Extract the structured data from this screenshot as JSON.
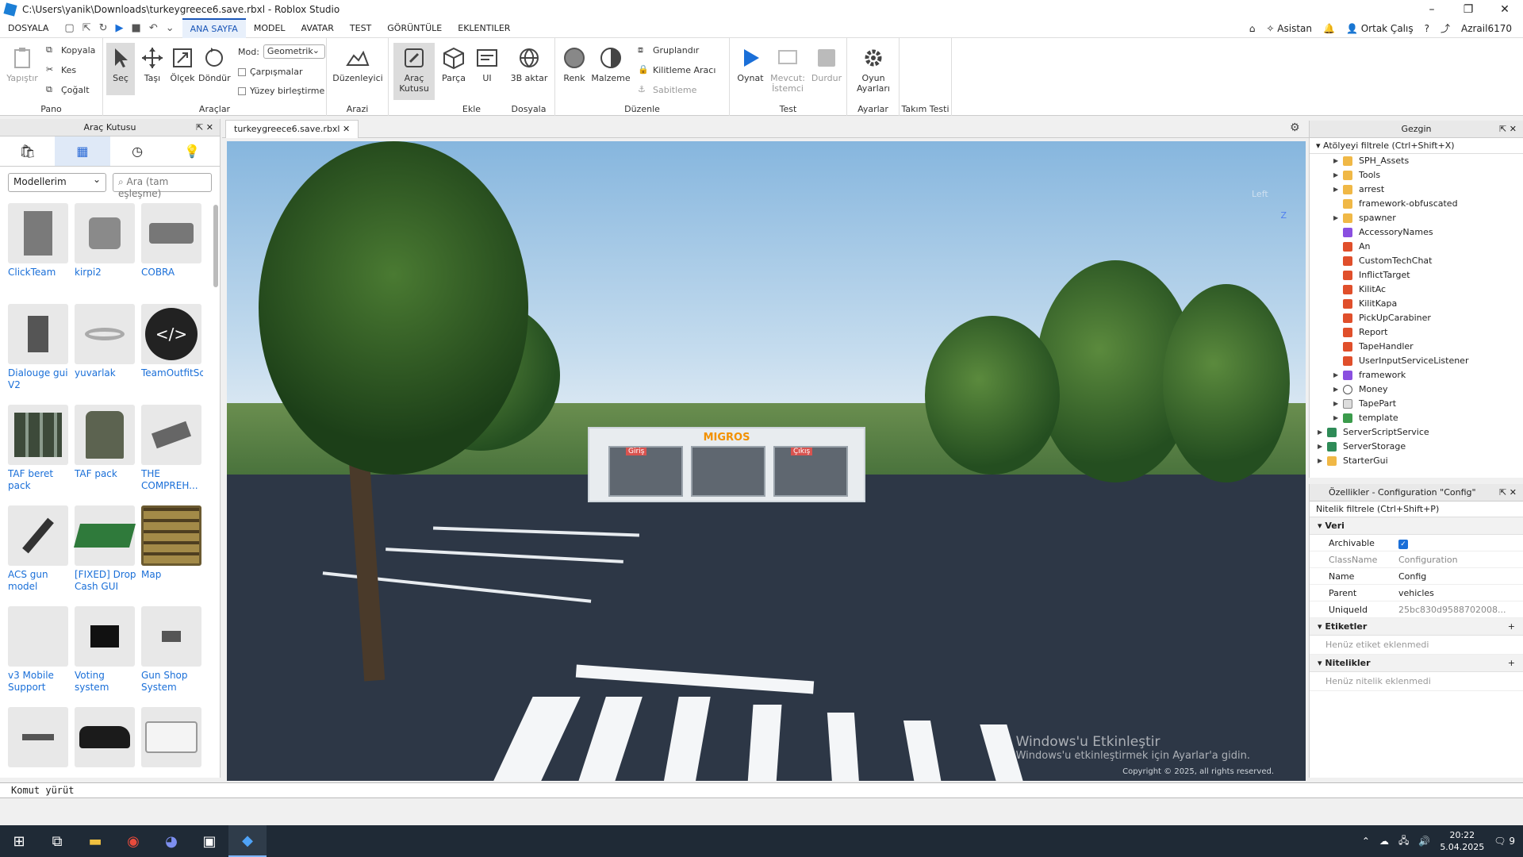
{
  "window": {
    "title": "C:\\Users\\yanik\\Downloads\\turkeygreece6.save.rbxl - Roblox Studio"
  },
  "menus": [
    "DOSYALA",
    "ANA SAYFA",
    "MODEL",
    "AVATAR",
    "TEST",
    "GÖRÜNTÜLE",
    "EKLENTILER"
  ],
  "menubar_right": {
    "assistant": "Asistan",
    "collab": "Ortak Çalış",
    "user": "Azrail6170"
  },
  "ribbon": {
    "pano": {
      "label": "Pano",
      "paste": "Yapıştır",
      "copy": "Kopyala",
      "cut": "Kes",
      "duplicate": "Çoğalt"
    },
    "araclar": {
      "label": "Araçlar",
      "select": "Seç",
      "move": "Taşı",
      "scale": "Ölçek",
      "rotate": "Döndür",
      "mode_label": "Mod:",
      "mode_value": "Geometrik",
      "collisions": "Çarpışmalar",
      "surface_join": "Yüzey birleştirme"
    },
    "arazi": {
      "label": "Arazi",
      "editor": "Düzenleyici"
    },
    "ekle": {
      "label": "Ekle",
      "toolbox": "Araç Kutusu",
      "part": "Parça",
      "ui": "UI"
    },
    "dosyala": {
      "label": "Dosyala",
      "import3d": "3B aktar"
    },
    "duzenle": {
      "label": "Düzenle",
      "color": "Renk",
      "material": "Malzeme",
      "group": "Gruplandır",
      "lock": "Kilitleme Aracı",
      "anchor": "Sabitleme"
    },
    "test": {
      "label": "Test",
      "play": "Oynat",
      "current": "Mevcut:",
      "client": "İstemci",
      "stop": "Durdur"
    },
    "ayarlar": {
      "label": "Ayarlar",
      "game_settings_1": "Oyun",
      "game_settings_2": "Ayarları"
    },
    "takim": {
      "label": "Takım Testi"
    }
  },
  "toolbox": {
    "title": "Araç Kutusu",
    "category": "Modellerim",
    "search_placeholder": "Ara (tam eşleşme)",
    "items": [
      "ClickTeam",
      "kirpi2",
      "COBRA",
      "Dialouge gui V2",
      "yuvarlak",
      "TeamOutfitScript",
      "TAF beret pack",
      "TAF pack",
      "THE COMPREH...",
      "ACS gun model",
      "[FIXED] Drop Cash GUI",
      "Map",
      "v3 Mobile Support",
      "Voting system",
      "Gun Shop System",
      "",
      "",
      ""
    ]
  },
  "document": {
    "tab": "turkeygreece6.save.rbxl"
  },
  "viewport": {
    "store_sign": "MIGROS",
    "door_label_1": "Giriş",
    "door_label_2": "Çıkış",
    "gizmo_label": "Left",
    "gizmo_axis": "Z",
    "footer": "Copyright © 2025, all rights reserved.",
    "activate_1": "Windows'u Etkinleştir",
    "activate_2": "Windows'u etkinleştirmek için Ayarlar'a gidin."
  },
  "explorer": {
    "title": "Gezgin",
    "filter": "Atölyeyi filtrele (Ctrl+Shift+X)",
    "rows": [
      {
        "name": "SPH_Assets",
        "icon": "folder",
        "indent": 1,
        "arrow": "▶"
      },
      {
        "name": "Tools",
        "icon": "folder",
        "indent": 1,
        "arrow": "▶"
      },
      {
        "name": "arrest",
        "icon": "folder",
        "indent": 1,
        "arrow": "▶"
      },
      {
        "name": "framework-obfuscated",
        "icon": "folder",
        "indent": 1,
        "arrow": ""
      },
      {
        "name": "spawner",
        "icon": "folder",
        "indent": 1,
        "arrow": "▶"
      },
      {
        "name": "AccessoryNames",
        "icon": "module",
        "indent": 1,
        "arrow": ""
      },
      {
        "name": "An",
        "icon": "script",
        "indent": 1,
        "arrow": ""
      },
      {
        "name": "CustomTechChat",
        "icon": "script",
        "indent": 1,
        "arrow": ""
      },
      {
        "name": "InflictTarget",
        "icon": "script",
        "indent": 1,
        "arrow": ""
      },
      {
        "name": "KilitAc",
        "icon": "script",
        "indent": 1,
        "arrow": ""
      },
      {
        "name": "KilitKapa",
        "icon": "script",
        "indent": 1,
        "arrow": ""
      },
      {
        "name": "PickUpCarabiner",
        "icon": "script",
        "indent": 1,
        "arrow": ""
      },
      {
        "name": "Report",
        "icon": "script",
        "indent": 1,
        "arrow": ""
      },
      {
        "name": "TapeHandler",
        "icon": "script",
        "indent": 1,
        "arrow": ""
      },
      {
        "name": "UserInputServiceListener",
        "icon": "script",
        "indent": 1,
        "arrow": ""
      },
      {
        "name": "framework",
        "icon": "module",
        "indent": 1,
        "arrow": "▶"
      },
      {
        "name": "Money",
        "icon": "globe",
        "indent": 1,
        "arrow": "▶"
      },
      {
        "name": "TapePart",
        "icon": "part",
        "indent": 1,
        "arrow": "▶"
      },
      {
        "name": "template",
        "icon": "green",
        "indent": 1,
        "arrow": "▶"
      },
      {
        "name": "ServerScriptService",
        "icon": "service",
        "indent": 0,
        "arrow": "▶"
      },
      {
        "name": "ServerStorage",
        "icon": "service",
        "indent": 0,
        "arrow": "▶"
      },
      {
        "name": "StarterGui",
        "icon": "folder",
        "indent": 0,
        "arrow": "▶"
      }
    ]
  },
  "properties": {
    "title": "Özellikler - Configuration \"Config\"",
    "filter": "Nitelik filtrele (Ctrl+Shift+P)",
    "section_data": "Veri",
    "archivable": "Archivable",
    "classname_k": "ClassName",
    "classname_v": "Configuration",
    "name_k": "Name",
    "name_v": "Config",
    "parent_k": "Parent",
    "parent_v": "vehicles",
    "uid_k": "UniqueId",
    "uid_v": "25bc830d9588702008...",
    "section_tags": "Etiketler",
    "tags_empty": "Henüz etiket eklenmedi",
    "section_attrs": "Nitelikler",
    "attrs_empty": "Henüz nitelik eklenmedi"
  },
  "command": {
    "placeholder": "Komut yürüt"
  },
  "taskbar": {
    "time": "20:22",
    "date": "5.04.2025",
    "notif": "9"
  }
}
